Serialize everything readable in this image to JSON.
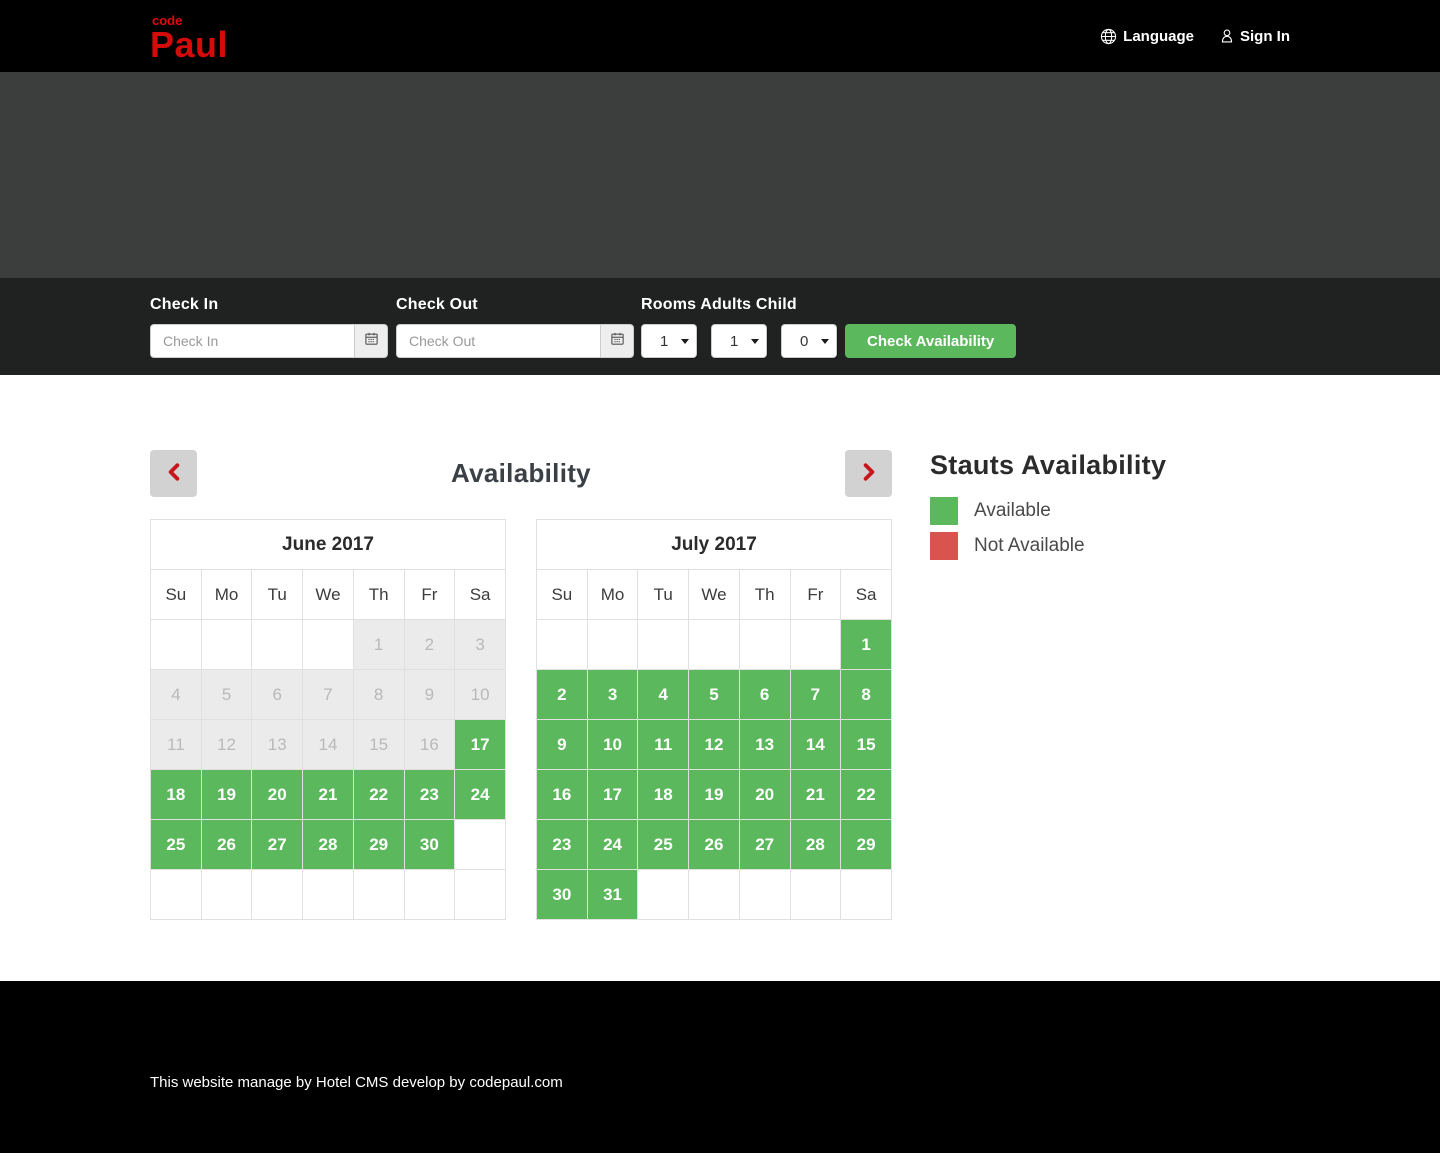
{
  "header": {
    "logo_top": "code",
    "logo_main": "Paul",
    "language_label": "Language",
    "signin_label": "Sign In"
  },
  "booking": {
    "checkin_label": "Check In",
    "checkin_placeholder": "Check In",
    "checkout_label": "Check Out",
    "checkout_placeholder": "Check Out",
    "rooms_adults_child_label": "Rooms Adults Child",
    "rooms_value": "1",
    "adults_value": "1",
    "child_value": "0",
    "check_availability_label": "Check Availability"
  },
  "availability": {
    "title": "Availability",
    "day_names": [
      "Su",
      "Mo",
      "Tu",
      "We",
      "Th",
      "Fr",
      "Sa"
    ],
    "months": [
      {
        "title": "June 2017",
        "weeks": [
          [
            {
              "d": "",
              "s": "empty"
            },
            {
              "d": "",
              "s": "empty"
            },
            {
              "d": "",
              "s": "empty"
            },
            {
              "d": "",
              "s": "empty"
            },
            {
              "d": "1",
              "s": "disabled"
            },
            {
              "d": "2",
              "s": "disabled"
            },
            {
              "d": "3",
              "s": "disabled"
            }
          ],
          [
            {
              "d": "4",
              "s": "disabled"
            },
            {
              "d": "5",
              "s": "disabled"
            },
            {
              "d": "6",
              "s": "disabled"
            },
            {
              "d": "7",
              "s": "disabled"
            },
            {
              "d": "8",
              "s": "disabled"
            },
            {
              "d": "9",
              "s": "disabled"
            },
            {
              "d": "10",
              "s": "disabled"
            }
          ],
          [
            {
              "d": "11",
              "s": "disabled"
            },
            {
              "d": "12",
              "s": "disabled"
            },
            {
              "d": "13",
              "s": "disabled"
            },
            {
              "d": "14",
              "s": "disabled"
            },
            {
              "d": "15",
              "s": "disabled"
            },
            {
              "d": "16",
              "s": "disabled"
            },
            {
              "d": "17",
              "s": "available"
            }
          ],
          [
            {
              "d": "18",
              "s": "available"
            },
            {
              "d": "19",
              "s": "available"
            },
            {
              "d": "20",
              "s": "available"
            },
            {
              "d": "21",
              "s": "available"
            },
            {
              "d": "22",
              "s": "available"
            },
            {
              "d": "23",
              "s": "available"
            },
            {
              "d": "24",
              "s": "available"
            }
          ],
          [
            {
              "d": "25",
              "s": "available"
            },
            {
              "d": "26",
              "s": "available"
            },
            {
              "d": "27",
              "s": "available"
            },
            {
              "d": "28",
              "s": "available"
            },
            {
              "d": "29",
              "s": "available"
            },
            {
              "d": "30",
              "s": "available"
            },
            {
              "d": "",
              "s": "empty"
            }
          ],
          [
            {
              "d": "",
              "s": "empty"
            },
            {
              "d": "",
              "s": "empty"
            },
            {
              "d": "",
              "s": "empty"
            },
            {
              "d": "",
              "s": "empty"
            },
            {
              "d": "",
              "s": "empty"
            },
            {
              "d": "",
              "s": "empty"
            },
            {
              "d": "",
              "s": "empty"
            }
          ]
        ]
      },
      {
        "title": "July 2017",
        "weeks": [
          [
            {
              "d": "",
              "s": "empty"
            },
            {
              "d": "",
              "s": "empty"
            },
            {
              "d": "",
              "s": "empty"
            },
            {
              "d": "",
              "s": "empty"
            },
            {
              "d": "",
              "s": "empty"
            },
            {
              "d": "",
              "s": "empty"
            },
            {
              "d": "1",
              "s": "available"
            }
          ],
          [
            {
              "d": "2",
              "s": "available"
            },
            {
              "d": "3",
              "s": "available"
            },
            {
              "d": "4",
              "s": "available"
            },
            {
              "d": "5",
              "s": "available"
            },
            {
              "d": "6",
              "s": "available"
            },
            {
              "d": "7",
              "s": "available"
            },
            {
              "d": "8",
              "s": "available"
            }
          ],
          [
            {
              "d": "9",
              "s": "available"
            },
            {
              "d": "10",
              "s": "available"
            },
            {
              "d": "11",
              "s": "available"
            },
            {
              "d": "12",
              "s": "available"
            },
            {
              "d": "13",
              "s": "available"
            },
            {
              "d": "14",
              "s": "available"
            },
            {
              "d": "15",
              "s": "available"
            }
          ],
          [
            {
              "d": "16",
              "s": "available"
            },
            {
              "d": "17",
              "s": "available"
            },
            {
              "d": "18",
              "s": "available"
            },
            {
              "d": "19",
              "s": "available"
            },
            {
              "d": "20",
              "s": "available"
            },
            {
              "d": "21",
              "s": "available"
            },
            {
              "d": "22",
              "s": "available"
            }
          ],
          [
            {
              "d": "23",
              "s": "available"
            },
            {
              "d": "24",
              "s": "available"
            },
            {
              "d": "25",
              "s": "available"
            },
            {
              "d": "26",
              "s": "available"
            },
            {
              "d": "27",
              "s": "available"
            },
            {
              "d": "28",
              "s": "available"
            },
            {
              "d": "29",
              "s": "available"
            }
          ],
          [
            {
              "d": "30",
              "s": "available"
            },
            {
              "d": "31",
              "s": "available"
            },
            {
              "d": "",
              "s": "empty"
            },
            {
              "d": "",
              "s": "empty"
            },
            {
              "d": "",
              "s": "empty"
            },
            {
              "d": "",
              "s": "empty"
            },
            {
              "d": "",
              "s": "empty"
            }
          ]
        ]
      }
    ],
    "legend": {
      "title": "Stauts Availability",
      "items": [
        {
          "label": "Available",
          "color": "#5cb85c"
        },
        {
          "label": "Not Available",
          "color": "#d9534f"
        }
      ]
    }
  },
  "footer": {
    "text": "This website manage by Hotel CMS develop by codepaul.com"
  },
  "colors": {
    "brand_red": "#d40b0b",
    "available_green": "#5cb85c",
    "not_available_red": "#d9534f"
  }
}
